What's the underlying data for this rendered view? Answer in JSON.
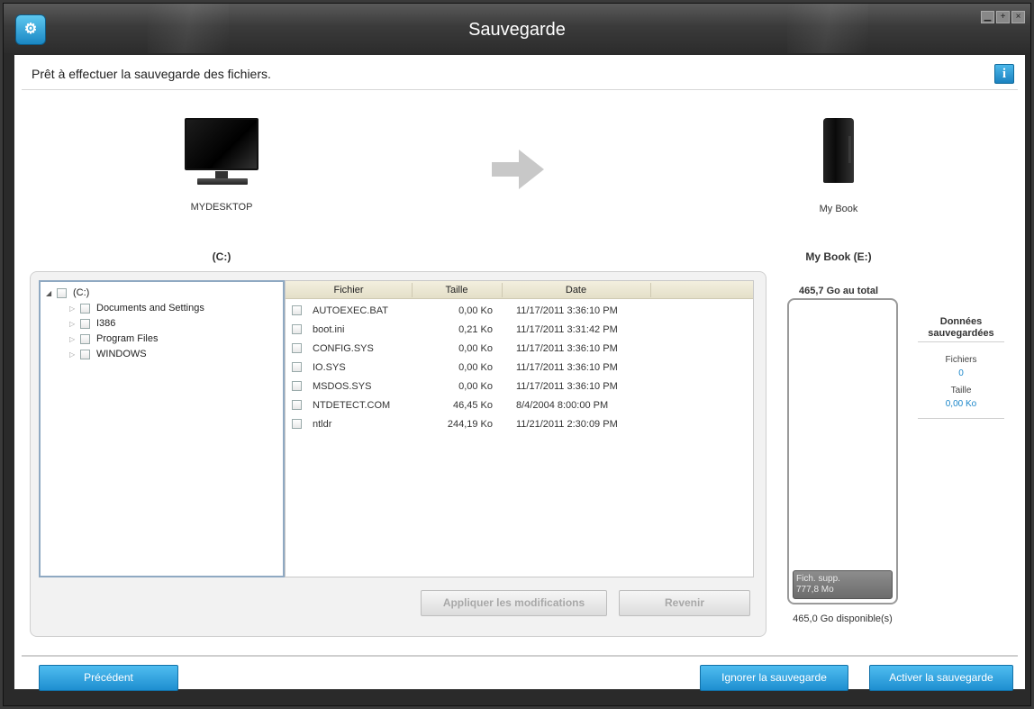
{
  "window": {
    "title": "Sauvegarde"
  },
  "header": {
    "status": "Prêt à effectuer la sauvegarde des fichiers."
  },
  "source": {
    "computer_name": "MYDESKTOP",
    "drive_label": "(C:)"
  },
  "target": {
    "device_name": "My Book",
    "drive_label": "My Book (E:)"
  },
  "tree": {
    "root": "(C:)",
    "children": [
      "Documents and Settings",
      "I386",
      "Program Files",
      "WINDOWS"
    ]
  },
  "files": {
    "columns": [
      "Fichier",
      "Taille",
      "Date"
    ],
    "rows": [
      {
        "name": "AUTOEXEC.BAT",
        "size": "0,00 Ko",
        "date": "11/17/2011 3:36:10 PM"
      },
      {
        "name": "boot.ini",
        "size": "0,21 Ko",
        "date": "11/17/2011 3:31:42 PM"
      },
      {
        "name": "CONFIG.SYS",
        "size": "0,00 Ko",
        "date": "11/17/2011 3:36:10 PM"
      },
      {
        "name": "IO.SYS",
        "size": "0,00 Ko",
        "date": "11/17/2011 3:36:10 PM"
      },
      {
        "name": "MSDOS.SYS",
        "size": "0,00 Ko",
        "date": "11/17/2011 3:36:10 PM"
      },
      {
        "name": "NTDETECT.COM",
        "size": "46,45 Ko",
        "date": "8/4/2004 8:00:00 PM"
      },
      {
        "name": "ntldr",
        "size": "244,19 Ko",
        "date": "11/21/2011 2:30:09 PM"
      }
    ]
  },
  "actions": {
    "apply": "Appliquer les modifications",
    "revert": "Revenir"
  },
  "capacity": {
    "total": "465,7 Go au total",
    "extra_label": "Fich. supp.",
    "extra_size": "777,8 Mo",
    "available": "465,0 Go disponible(s)"
  },
  "saved_data": {
    "title": "Données sauvegardées",
    "files_label": "Fichiers",
    "files_value": "0",
    "size_label": "Taille",
    "size_value": "0,00 Ko"
  },
  "footer": {
    "previous": "Précédent",
    "skip": "Ignorer la sauvegarde",
    "activate": "Activer la sauvegarde"
  },
  "colors": {
    "accent": "#1e8ed0",
    "value_blue": "#1a86c9"
  }
}
